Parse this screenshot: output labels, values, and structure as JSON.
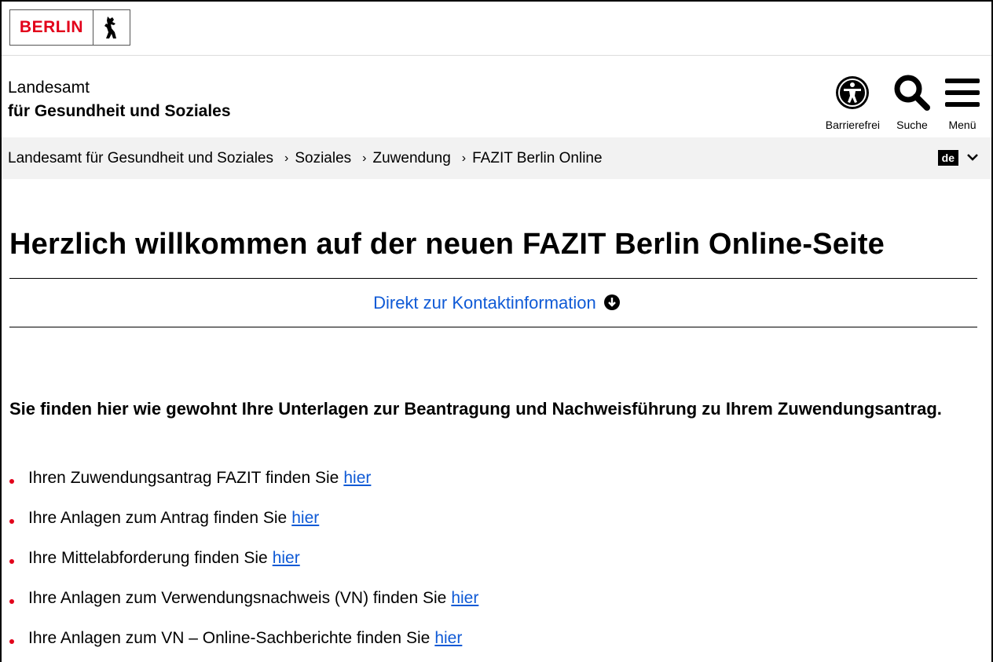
{
  "logo": {
    "text": "BERLIN"
  },
  "header": {
    "agency_line1": "Landesamt",
    "agency_line2": "für Gesundheit und Soziales",
    "tools": [
      {
        "label": "Barrierefrei",
        "icon": "accessibility-icon"
      },
      {
        "label": "Suche",
        "icon": "search-icon"
      },
      {
        "label": "Menü",
        "icon": "menu-icon"
      }
    ]
  },
  "breadcrumb": [
    "Landesamt für Gesundheit und Soziales",
    "Soziales",
    "Zuwendung",
    "FAZIT Berlin Online"
  ],
  "language": {
    "current": "de"
  },
  "main": {
    "title": "Herzlich willkommen auf der neuen FAZIT Berlin Online-Seite",
    "contact_link": "Direkt zur Kontaktinformation",
    "intro": "Sie finden hier wie gewohnt Ihre Unterlagen zur Beantragung und Nachweisführung zu Ihrem Zuwendungsantrag.",
    "items": [
      {
        "text": "Ihren Zuwendungsantrag FAZIT finden Sie",
        "link": "hier"
      },
      {
        "text": "Ihre Anlagen zum Antrag finden Sie",
        "link": "hier"
      },
      {
        "text": "Ihre Mittelabforderung finden Sie",
        "link": "hier"
      },
      {
        "text": "Ihre Anlagen zum Verwendungsnachweis (VN) finden Sie",
        "link": "hier"
      },
      {
        "text": "Ihre Anlagen zum VN – Online-Sachberichte finden Sie",
        "link": "hier"
      }
    ]
  },
  "colors": {
    "brand_red": "#e2001a",
    "link_blue": "#0f5ad6",
    "crumb_bg": "#f2f2f2"
  }
}
